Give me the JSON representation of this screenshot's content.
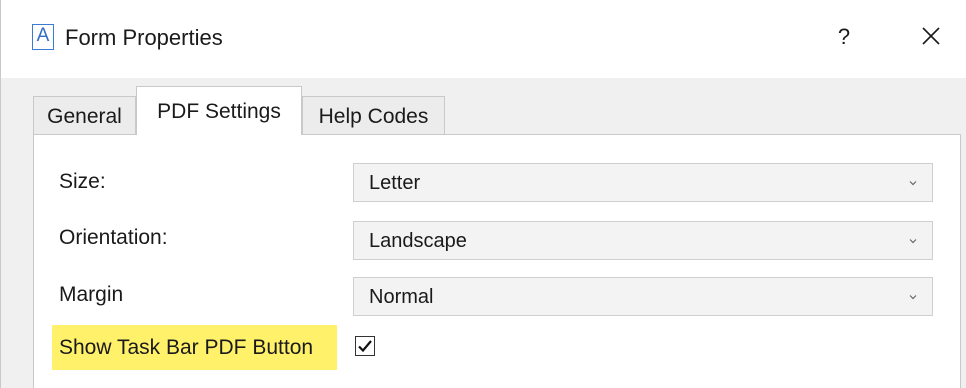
{
  "window": {
    "app_icon_letter": "A",
    "title": "Form Properties",
    "help_label": "?"
  },
  "tabs": [
    {
      "label": "General",
      "selected": false
    },
    {
      "label": "PDF Settings",
      "selected": true
    },
    {
      "label": "Help Codes",
      "selected": false
    }
  ],
  "fields": {
    "size": {
      "label": "Size:",
      "value": "Letter"
    },
    "orientation": {
      "label": "Orientation:",
      "value": "Landscape"
    },
    "margin": {
      "label": "Margin",
      "value": "Normal"
    },
    "show_taskbar_pdf": {
      "label": "Show Task Bar PDF Button",
      "checked": true
    }
  },
  "colors": {
    "highlight": "#fff16a",
    "accent": "#2f6fc9"
  }
}
